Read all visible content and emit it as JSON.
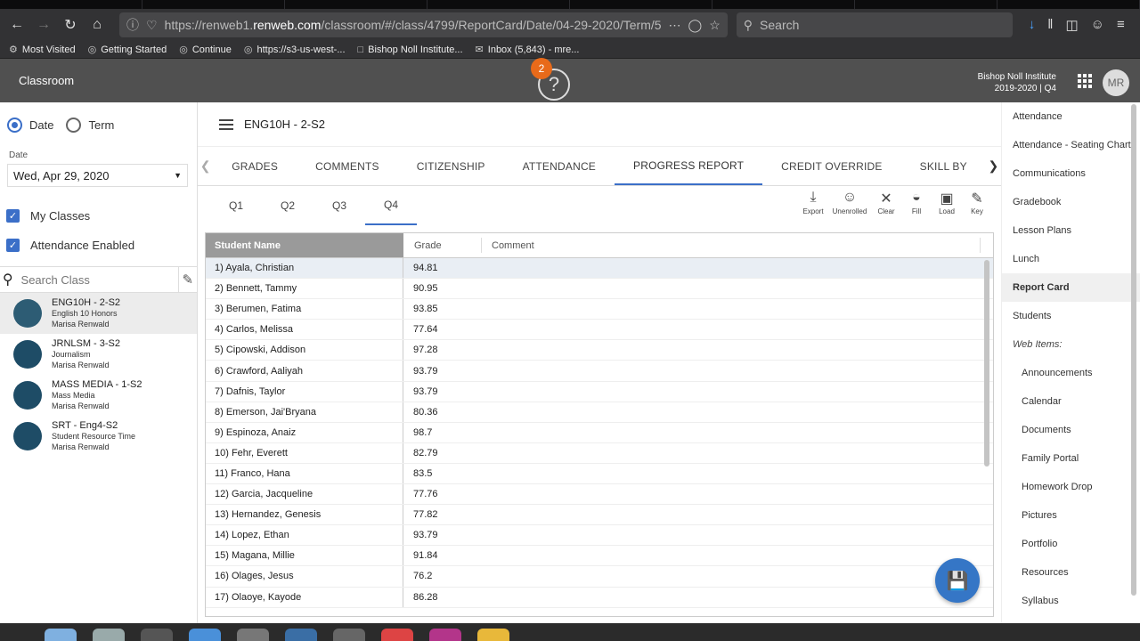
{
  "browser": {
    "url_prefix": "https://renweb1.",
    "url_domain": "renweb.com",
    "url_path": "/classroom/#/class/4799/ReportCard/Date/04-29-2020/Term/5",
    "search_placeholder": "Search",
    "bookmarks": [
      {
        "label": "Most Visited",
        "icon": "gear-icon"
      },
      {
        "label": "Getting Started",
        "icon": "globe-icon"
      },
      {
        "label": "Continue",
        "icon": "globe-icon"
      },
      {
        "label": "https://s3-us-west-...",
        "icon": "globe-icon"
      },
      {
        "label": "Bishop Noll Institute...",
        "icon": "page-icon"
      },
      {
        "label": "Inbox (5,843) - mre...",
        "icon": "mail-icon"
      }
    ]
  },
  "header": {
    "title": "Classroom",
    "help_badge": "2",
    "school_name": "Bishop Noll Institute",
    "school_term": "2019-2020 | Q4",
    "avatar_initials": "MR"
  },
  "left": {
    "date_radio": "Date",
    "term_radio": "Term",
    "date_label": "Date",
    "date_value": "Wed, Apr 29, 2020",
    "my_classes": "My Classes",
    "attendance_enabled": "Attendance Enabled",
    "search_placeholder": "Search Class",
    "classes": [
      {
        "name": "ENG10H - 2-S2",
        "subject": "English 10 Honors",
        "teacher": "Marisa Renwald"
      },
      {
        "name": "JRNLSM - 3-S2",
        "subject": "Journalism",
        "teacher": "Marisa Renwald"
      },
      {
        "name": "MASS MEDIA - 1-S2",
        "subject": "Mass Media",
        "teacher": "Marisa Renwald"
      },
      {
        "name": "SRT - Eng4-S2",
        "subject": "Student Resource Time",
        "teacher": "Marisa Renwald"
      }
    ]
  },
  "center": {
    "class_title": "ENG10H - 2-S2",
    "tabs": [
      "GRADES",
      "COMMENTS",
      "CITIZENSHIP",
      "ATTENDANCE",
      "PROGRESS REPORT",
      "CREDIT OVERRIDE",
      "SKILL BY"
    ],
    "quarters": [
      "Q1",
      "Q2",
      "Q3",
      "Q4"
    ],
    "tools": [
      "Export",
      "Unenrolled",
      "Clear",
      "Fill",
      "Load",
      "Key"
    ],
    "columns": {
      "name": "Student Name",
      "grade": "Grade",
      "comment": "Comment"
    },
    "students": [
      {
        "name": "1) Ayala, Christian",
        "grade": "94.81"
      },
      {
        "name": "2) Bennett, Tammy",
        "grade": "90.95"
      },
      {
        "name": "3) Berumen, Fatima",
        "grade": "93.85"
      },
      {
        "name": "4) Carlos, Melissa",
        "grade": "77.64"
      },
      {
        "name": "5) Cipowski, Addison",
        "grade": "97.28"
      },
      {
        "name": "6) Crawford, Aaliyah",
        "grade": "93.79"
      },
      {
        "name": "7) Dafnis, Taylor",
        "grade": "93.79"
      },
      {
        "name": "8) Emerson, Jai'Bryana",
        "grade": "80.36"
      },
      {
        "name": "9) Espinoza, Anaiz",
        "grade": "98.7"
      },
      {
        "name": "10) Fehr, Everett",
        "grade": "82.79"
      },
      {
        "name": "11) Franco, Hana",
        "grade": "83.5"
      },
      {
        "name": "12) Garcia, Jacqueline",
        "grade": "77.76"
      },
      {
        "name": "13) Hernandez, Genesis",
        "grade": "77.82"
      },
      {
        "name": "14) Lopez, Ethan",
        "grade": "93.79"
      },
      {
        "name": "15) Magana, Millie",
        "grade": "91.84"
      },
      {
        "name": "16) Olages, Jesus",
        "grade": "76.2"
      },
      {
        "name": "17) Olaoye, Kayode",
        "grade": "86.28"
      }
    ]
  },
  "right_nav": {
    "items": [
      "Attendance",
      "Attendance - Seating Chart",
      "Communications",
      "Gradebook",
      "Lesson Plans",
      "Lunch",
      "Report Card",
      "Students"
    ],
    "web_items_header": "Web Items:",
    "web_items": [
      "Announcements",
      "Calendar",
      "Documents",
      "Family Portal",
      "Homework Drop",
      "Pictures",
      "Portfolio",
      "Resources",
      "Syllabus"
    ]
  },
  "colors": {
    "accent": "#3b6fc8",
    "header_bg": "#505050",
    "fab": "#3576c6",
    "class_dot": "#1e4c66"
  }
}
